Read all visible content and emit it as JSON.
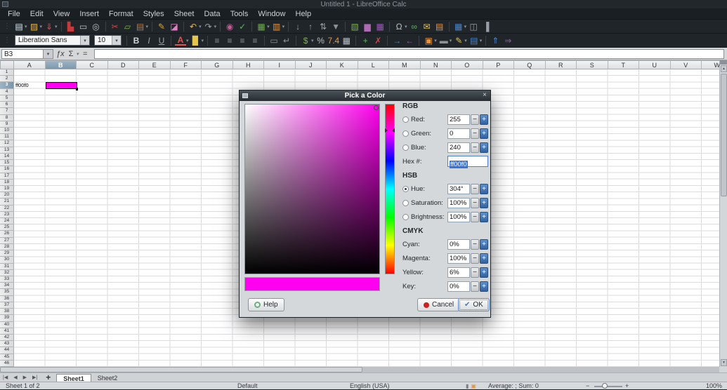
{
  "window": {
    "title": "Untitled 1 - LibreOffice Calc"
  },
  "menu_items": [
    "File",
    "Edit",
    "View",
    "Insert",
    "Format",
    "Styles",
    "Sheet",
    "Data",
    "Tools",
    "Window",
    "Help"
  ],
  "toolbar_standard": [
    {
      "name": "new-document",
      "glyph": "▤",
      "color": "#d8e6ee",
      "dd": true
    },
    {
      "name": "open-file",
      "glyph": "▨",
      "color": "#e5b44a",
      "dd": true
    },
    {
      "name": "save",
      "glyph": "⇓",
      "color": "#e05252",
      "dd": true
    },
    {
      "sep": true
    },
    {
      "name": "export-pdf",
      "glyph": "▙",
      "color": "#c43b3b"
    },
    {
      "name": "print",
      "glyph": "▭",
      "color": "#b9c0c6"
    },
    {
      "name": "print-preview",
      "glyph": "◎",
      "color": "#b9c0c6"
    },
    {
      "sep": true
    },
    {
      "name": "cut",
      "glyph": "✂",
      "color": "#d44444"
    },
    {
      "name": "copy",
      "glyph": "▱",
      "color": "#79b24a"
    },
    {
      "name": "paste",
      "glyph": "▤",
      "color": "#b07b4f",
      "dd": true
    },
    {
      "sep": true
    },
    {
      "name": "clone-formatting",
      "glyph": "✎",
      "color": "#d9a23c"
    },
    {
      "name": "clear-formatting",
      "glyph": "◪",
      "color": "#df7fc2"
    },
    {
      "sep": true
    },
    {
      "name": "undo",
      "glyph": "↶",
      "color": "#e0b44c",
      "dd": true
    },
    {
      "name": "redo",
      "glyph": "↷",
      "color": "#98a0a6",
      "dd": true
    },
    {
      "sep": true
    },
    {
      "name": "find-and-replace",
      "glyph": "◉",
      "color": "#c05c92"
    },
    {
      "name": "spelling",
      "glyph": "✓",
      "color": "#5cb85c"
    },
    {
      "sep": true
    },
    {
      "name": "insert-row",
      "glyph": "▦",
      "color": "#6fae4e",
      "dd": true
    },
    {
      "name": "insert-column",
      "glyph": "▥",
      "color": "#e8963c",
      "dd": true
    },
    {
      "sep": true
    },
    {
      "name": "sort-ascending",
      "glyph": "↓",
      "color": "#98a0a6"
    },
    {
      "name": "sort-descending",
      "glyph": "↑",
      "color": "#98a0a6"
    },
    {
      "name": "sort",
      "glyph": "⇅",
      "color": "#98a0a6"
    },
    {
      "name": "autofilter",
      "glyph": "▼",
      "color": "#8a9197"
    },
    {
      "sep": true
    },
    {
      "name": "insert-image",
      "glyph": "▧",
      "color": "#79b24a"
    },
    {
      "name": "insert-chart",
      "glyph": "▆",
      "color": "#b06ab3"
    },
    {
      "name": "insert-pivot-table",
      "glyph": "▦",
      "color": "#9b59b6"
    },
    {
      "sep": true
    },
    {
      "name": "insert-special-character",
      "glyph": "Ω",
      "color": "#b9c0c6",
      "dd": true
    },
    {
      "name": "insert-hyperlink",
      "glyph": "∞",
      "color": "#5cb85c"
    },
    {
      "name": "insert-comment",
      "glyph": "✉",
      "color": "#e3c44d"
    },
    {
      "name": "headers-and-footers",
      "glyph": "▤",
      "color": "#e8963c"
    },
    {
      "sep": true
    },
    {
      "name": "freeze-rows-and-columns",
      "glyph": "▦",
      "color": "#4a84c8",
      "dd": true
    },
    {
      "name": "split-window",
      "glyph": "◫",
      "color": "#98a0a6"
    },
    {
      "name": "sidebar",
      "glyph": "▐",
      "color": "#98a0a6"
    }
  ],
  "toolbar_formatting": {
    "font_name": "Liberation Sans",
    "font_size": "10",
    "icons": [
      {
        "name": "bold",
        "glyph": "B",
        "color": "#cfd4d8",
        "cls": "b"
      },
      {
        "name": "italic",
        "glyph": "I",
        "color": "#9aa1a7",
        "cls": "i"
      },
      {
        "name": "underline",
        "glyph": "U",
        "color": "#9aa1a7",
        "cls": "u"
      },
      {
        "sep": true
      },
      {
        "name": "font-color",
        "glyph": "A",
        "color": "#e05252",
        "cls": "fc",
        "dd": true
      },
      {
        "name": "highlighting-color",
        "glyph": "▉",
        "color": "#e3c44d",
        "dd": true
      },
      {
        "sep": true
      },
      {
        "name": "align-left",
        "glyph": "≡",
        "color": "#8a9197"
      },
      {
        "name": "align-center",
        "glyph": "≡",
        "color": "#8a9197"
      },
      {
        "name": "align-right",
        "glyph": "≡",
        "color": "#8a9197"
      },
      {
        "name": "justified",
        "glyph": "≡",
        "color": "#8a9197"
      },
      {
        "sep": true
      },
      {
        "name": "merge-cells",
        "glyph": "▭",
        "color": "#8a9197"
      },
      {
        "name": "wrap-text",
        "glyph": "↵",
        "color": "#8a9197"
      },
      {
        "sep": true
      },
      {
        "name": "format-as-currency",
        "glyph": "$",
        "color": "#79b24a",
        "dd": true
      },
      {
        "name": "format-as-percent",
        "glyph": "%",
        "color": "#b9c0c6"
      },
      {
        "name": "format-as-number",
        "glyph": "7.4",
        "color": "#e8963c"
      },
      {
        "name": "format-as-date",
        "glyph": "▦",
        "color": "#b9c0c6"
      },
      {
        "sep": true
      },
      {
        "name": "add-decimal-place",
        "glyph": "+",
        "color": "#5cb85c"
      },
      {
        "name": "delete-decimal-place",
        "glyph": "✗",
        "color": "#d44444"
      },
      {
        "sep": true
      },
      {
        "name": "increase-indent",
        "glyph": "→",
        "color": "#4a84c8"
      },
      {
        "name": "decrease-indent",
        "glyph": "←",
        "color": "#9b59b6"
      },
      {
        "sep": true
      },
      {
        "name": "borders",
        "glyph": "▣",
        "color": "#e8963c",
        "dd": true
      },
      {
        "name": "border-style",
        "glyph": "▬",
        "color": "#8a9197",
        "dd": true
      },
      {
        "name": "border-color",
        "glyph": "✎",
        "color": "#e3c44d",
        "dd": true
      },
      {
        "name": "conditional-formatting",
        "glyph": "▤",
        "color": "#4a84c8",
        "dd": true
      },
      {
        "sep": true
      },
      {
        "name": "insert-rows-above",
        "glyph": "⇑",
        "color": "#4a84c8"
      },
      {
        "name": "insert-columns-after",
        "glyph": "⇒",
        "color": "#9b59b6"
      }
    ]
  },
  "formula_bar": {
    "cell_reference": "B3",
    "fx_label": "ƒx",
    "sum_label": "Σ",
    "equals_label": "=",
    "input_value": ""
  },
  "grid": {
    "columns": [
      "A",
      "B",
      "C",
      "D",
      "E",
      "F",
      "G",
      "H",
      "I",
      "J",
      "K",
      "L",
      "M",
      "N",
      "O",
      "P",
      "Q",
      "R",
      "S",
      "T",
      "U",
      "V",
      "W"
    ],
    "row_count": 46,
    "selected_column": "B",
    "selected_row": 3,
    "cell_a3": "ff00f0",
    "selected_fill": "#ff00f0"
  },
  "dialog": {
    "title": "Pick a Color",
    "spin_minus": "−",
    "spin_plus": "+",
    "picker": {
      "hue_degrees": 304,
      "selected_color": "#ff00f0"
    },
    "sections": [
      {
        "heading": "RGB",
        "rows": [
          {
            "id": "red",
            "label": "Red:",
            "value": "255",
            "radio": true,
            "selected": false
          },
          {
            "id": "green",
            "label": "Green:",
            "value": "0",
            "radio": true,
            "selected": false
          },
          {
            "id": "blue",
            "label": "Blue:",
            "value": "240",
            "radio": true,
            "selected": false
          },
          {
            "id": "hex",
            "label": "Hex #:",
            "value": "ff00f0",
            "type": "hex"
          }
        ]
      },
      {
        "heading": "HSB",
        "rows": [
          {
            "id": "hue",
            "label": "Hue:",
            "value": "304°",
            "radio": true,
            "selected": true
          },
          {
            "id": "saturation",
            "label": "Saturation:",
            "value": "100%",
            "radio": true,
            "selected": false
          },
          {
            "id": "brightness",
            "label": "Brightness:",
            "value": "100%",
            "radio": true,
            "selected": false
          }
        ]
      },
      {
        "heading": "CMYK",
        "rows": [
          {
            "id": "cyan",
            "label": "Cyan:",
            "value": "0%",
            "radio": false
          },
          {
            "id": "magenta",
            "label": "Magenta:",
            "value": "100%",
            "radio": false
          },
          {
            "id": "yellow",
            "label": "Yellow:",
            "value": "6%",
            "radio": false
          },
          {
            "id": "key",
            "label": "Key:",
            "value": "0%",
            "radio": false
          }
        ]
      }
    ],
    "buttons": {
      "help": "Help",
      "cancel": "Cancel",
      "ok": "OK"
    }
  },
  "sheet_bar": {
    "nav": [
      {
        "name": "first-sheet-button",
        "glyph": "|◀"
      },
      {
        "name": "previous-sheet-button",
        "glyph": "◀"
      },
      {
        "name": "next-sheet-button",
        "glyph": "▶"
      },
      {
        "name": "last-sheet-button",
        "glyph": "▶|"
      }
    ],
    "add_label": "+",
    "tabs": [
      {
        "label": "Sheet1",
        "active": true
      },
      {
        "label": "Sheet2",
        "active": false
      }
    ]
  },
  "status_bar": {
    "sheet_position": "Sheet 1 of 2",
    "page_style": "Default",
    "language": "English (USA)",
    "icons": [
      {
        "name": "insert-mode-icon",
        "glyph": "▮",
        "color": "#7a8086"
      },
      {
        "name": "selection-mode-icon",
        "glyph": "▣",
        "color": "#e8963c"
      }
    ],
    "selection_summary": "Average: ; Sum: 0",
    "zoom_out": "−",
    "zoom_in": "+",
    "zoom_level": "100%"
  }
}
